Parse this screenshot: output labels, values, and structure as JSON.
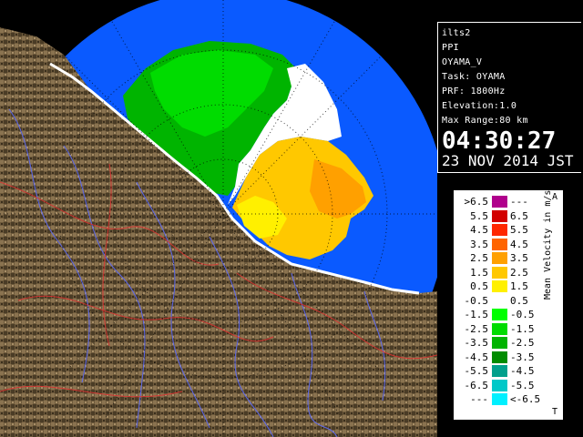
{
  "info": {
    "host": "ilts2",
    "product": "PPI",
    "site": "OYAMA_V",
    "task": "Task: OYAMA",
    "prf": "PRF: 1800Hz",
    "elevation": "Elevation:1.0",
    "max_range": "Max Range:80 km",
    "time": "04:30:27",
    "date": "23 NOV 2014 JST"
  },
  "legend": {
    "title": "Mean Velocity in m/s",
    "corner_top": "A",
    "corner_bottom": "T",
    "rows": [
      {
        "left": ">6.5",
        "right": "---",
        "color": "#b0008c"
      },
      {
        "left": "5.5",
        "right": "6.5",
        "color": "#d20000"
      },
      {
        "left": "4.5",
        "right": "5.5",
        "color": "#ff2800"
      },
      {
        "left": "3.5",
        "right": "4.5",
        "color": "#ff6400"
      },
      {
        "left": "2.5",
        "right": "3.5",
        "color": "#ffa000"
      },
      {
        "left": "1.5",
        "right": "2.5",
        "color": "#ffc800"
      },
      {
        "left": "0.5",
        "right": "1.5",
        "color": "#fff000"
      },
      {
        "left": "-0.5",
        "right": "0.5",
        "color": "#ffffff"
      },
      {
        "left": "-1.5",
        "right": "-0.5",
        "color": "#00ff00"
      },
      {
        "left": "-2.5",
        "right": "-1.5",
        "color": "#00dc00"
      },
      {
        "left": "-3.5",
        "right": "-2.5",
        "color": "#00b400"
      },
      {
        "left": "-4.5",
        "right": "-3.5",
        "color": "#008c00"
      },
      {
        "left": "-5.5",
        "right": "-4.5",
        "color": "#00a08c"
      },
      {
        "left": "-6.5",
        "right": "-5.5",
        "color": "#00c8c8"
      },
      {
        "left": "---",
        "right": "<-6.5",
        "color": "#00f0ff"
      }
    ]
  },
  "colors": {
    "coverage": "#0a5aff",
    "terrain_dark": "#5a4a30",
    "terrain_light": "#9a8260"
  }
}
